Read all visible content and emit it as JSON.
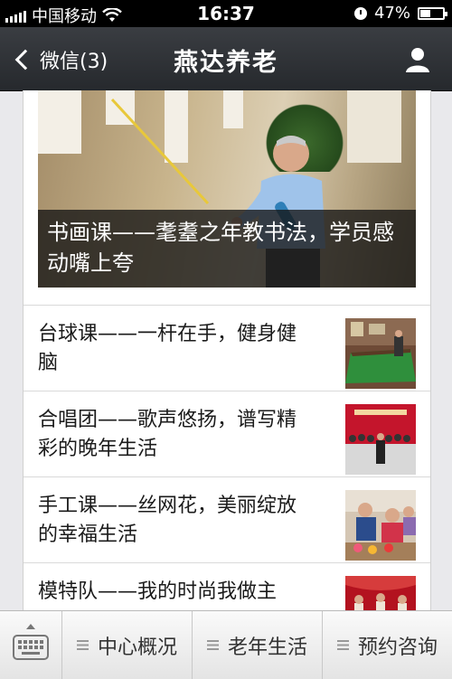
{
  "status_bar": {
    "carrier": "中国移动",
    "time": "16:37",
    "battery": "47%",
    "battery_level": 0.47
  },
  "nav": {
    "back_label": "微信(3)",
    "title": "燕达养老"
  },
  "hero": {
    "caption": "书画课——耄耋之年教书法，学员感动嘴上夸"
  },
  "articles": [
    {
      "title": "台球课——一杆在手，健身健脑"
    },
    {
      "title": "合唱团——歌声悠扬，谱写精彩的晚年生活"
    },
    {
      "title": "手工课——丝网花，美丽绽放的幸福生活"
    },
    {
      "title": "模特队——我的时尚我做主"
    }
  ],
  "bottom_menu": {
    "tabs": [
      {
        "label": "中心概况"
      },
      {
        "label": "老年生活"
      },
      {
        "label": "预约咨询"
      }
    ]
  }
}
